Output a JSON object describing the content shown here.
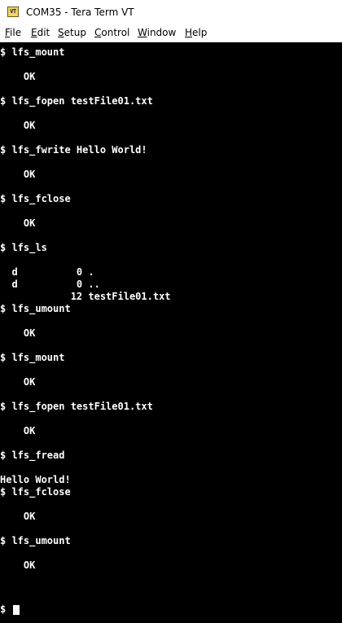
{
  "window": {
    "icon_text": "VT",
    "title": "COM35 - Tera Term VT"
  },
  "menu": [
    {
      "accel": "F",
      "rest": "ile"
    },
    {
      "accel": "E",
      "rest": "dit"
    },
    {
      "accel": "S",
      "rest": "etup"
    },
    {
      "accel": "C",
      "rest": "ontrol"
    },
    {
      "accel": "W",
      "rest": "indow"
    },
    {
      "accel": "H",
      "rest": "elp"
    }
  ],
  "terminal": {
    "lines": [
      "$ lfs_mount",
      "",
      "    OK",
      "",
      "$ lfs_fopen testFile01.txt",
      "",
      "    OK",
      "",
      "$ lfs_fwrite Hello World!",
      "",
      "    OK",
      "",
      "$ lfs_fclose",
      "",
      "    OK",
      "",
      "$ lfs_ls",
      "",
      "  d          0 .",
      "  d          0 ..",
      "            12 testFile01.txt",
      "$ lfs_umount",
      "",
      "    OK",
      "",
      "$ lfs_mount",
      "",
      "    OK",
      "",
      "$ lfs_fopen testFile01.txt",
      "",
      "    OK",
      "",
      "$ lfs_fread",
      "",
      "Hello World!",
      "$ lfs_fclose",
      "",
      "    OK",
      "",
      "$ lfs_umount",
      "",
      "    OK",
      ""
    ],
    "prompt": "$ "
  }
}
